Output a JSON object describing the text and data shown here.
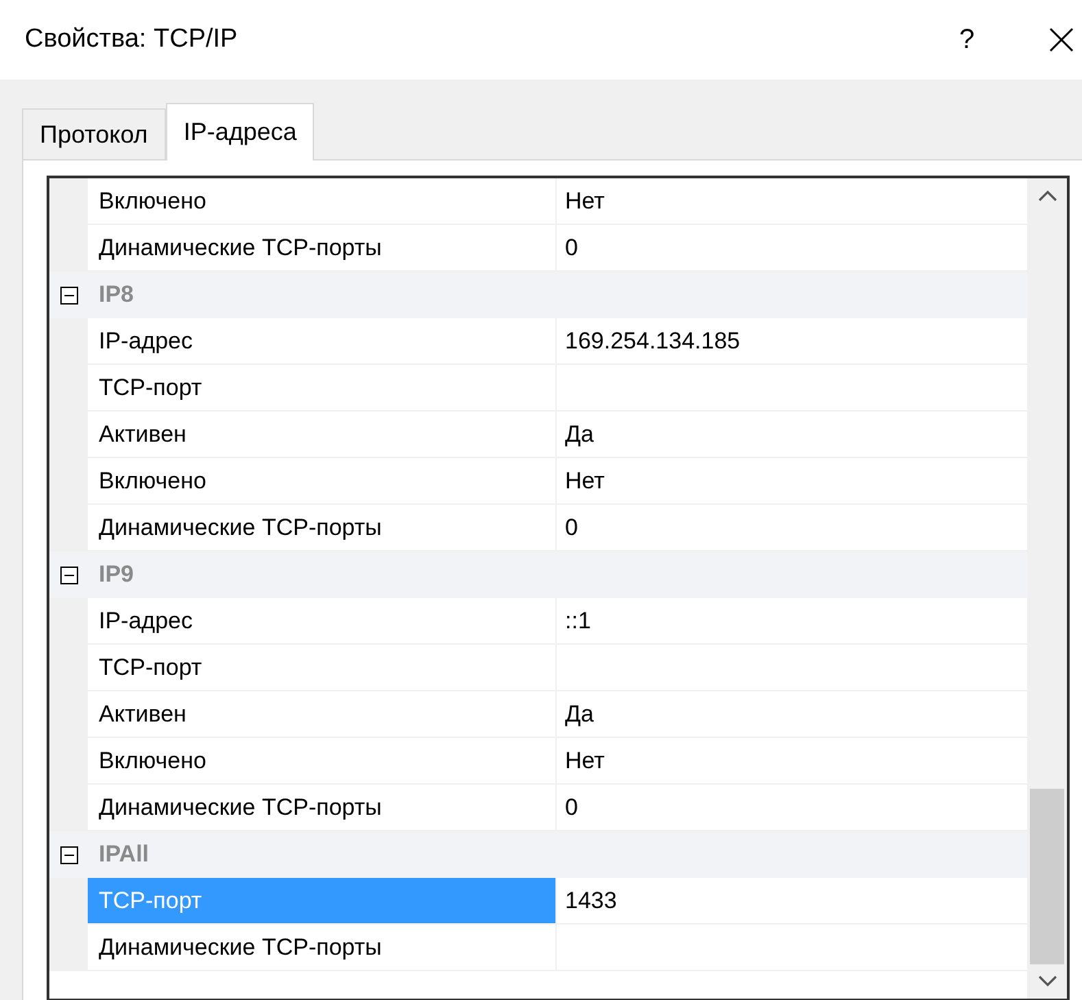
{
  "window": {
    "title": "Свойства: TCP/IP",
    "help": "?"
  },
  "tabs": [
    {
      "label": "Протокол",
      "selected": false
    },
    {
      "label": "IP-адреса",
      "selected": true
    }
  ],
  "leading_rows": [
    {
      "label": "Включено",
      "value": "Нет",
      "selected": false
    },
    {
      "label": "Динамические TCP-порты",
      "value": "0",
      "selected": false
    }
  ],
  "groups": [
    {
      "name": "IP8",
      "expanded": true,
      "rows": [
        {
          "label": "IP-адрес",
          "value": "169.254.134.185",
          "selected": false
        },
        {
          "label": "TCP-порт",
          "selected": false
        },
        {
          "label": "Активен",
          "value": "Да",
          "selected": false
        },
        {
          "label": "Включено",
          "value": "Нет",
          "selected": false
        },
        {
          "label": "Динамические TCP-порты",
          "value": "0",
          "selected": false
        }
      ]
    },
    {
      "name": "IP9",
      "expanded": true,
      "rows": [
        {
          "label": "IP-адрес",
          "value": "::1",
          "selected": false
        },
        {
          "label": "TCP-порт",
          "selected": false
        },
        {
          "label": "Активен",
          "value": "Да",
          "selected": false
        },
        {
          "label": "Включено",
          "value": "Нет",
          "selected": false
        },
        {
          "label": "Динамические TCP-порты",
          "value": "0",
          "selected": false
        }
      ]
    },
    {
      "name": "IPAll",
      "expanded": true,
      "rows": [
        {
          "label": "TCP-порт",
          "value": "1433",
          "selected": true
        },
        {
          "label": "Динамические TCP-порты",
          "selected": false
        }
      ]
    }
  ]
}
